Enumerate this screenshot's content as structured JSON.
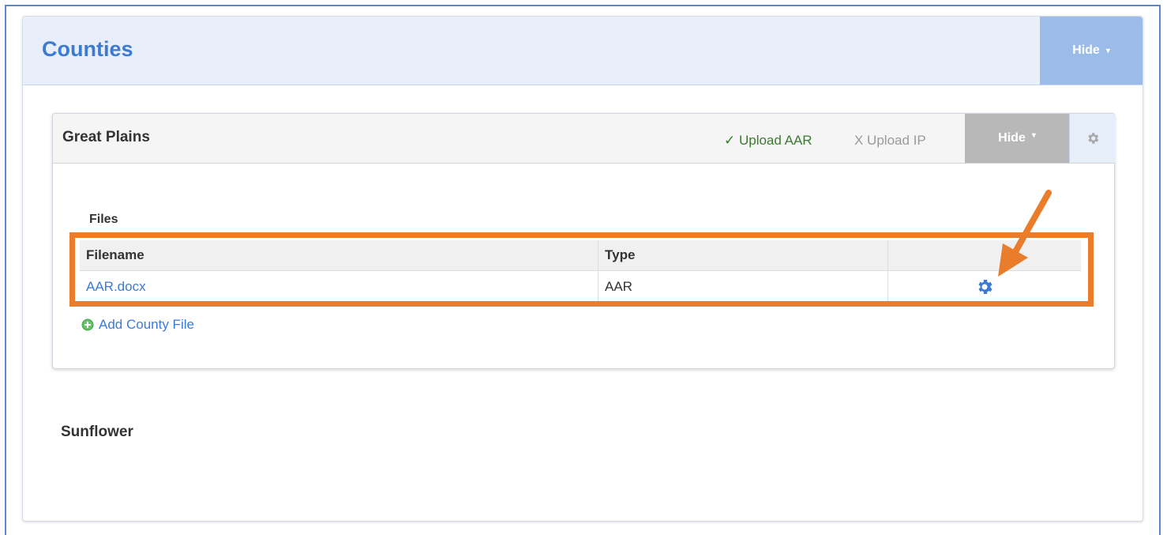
{
  "outer_panel": {
    "title": "Counties",
    "hide_label": "Hide",
    "hide_caret": "▾"
  },
  "county_panel": {
    "title": "Great Plains",
    "upload_aar": "✓ Upload AAR",
    "upload_ip": "X Upload IP",
    "hide_label": "Hide",
    "hide_caret": "▾"
  },
  "files": {
    "section_label": "Files",
    "columns": [
      "Filename",
      "Type",
      ""
    ],
    "rows": [
      {
        "filename": "AAR.docx",
        "type": "AAR"
      }
    ],
    "add_label": "Add County File"
  },
  "next_county": {
    "title": "Sunflower"
  },
  "colors": {
    "accent": "#3c7bd0",
    "highlight": "#ea7d2c",
    "success": "#3b7a2f"
  }
}
